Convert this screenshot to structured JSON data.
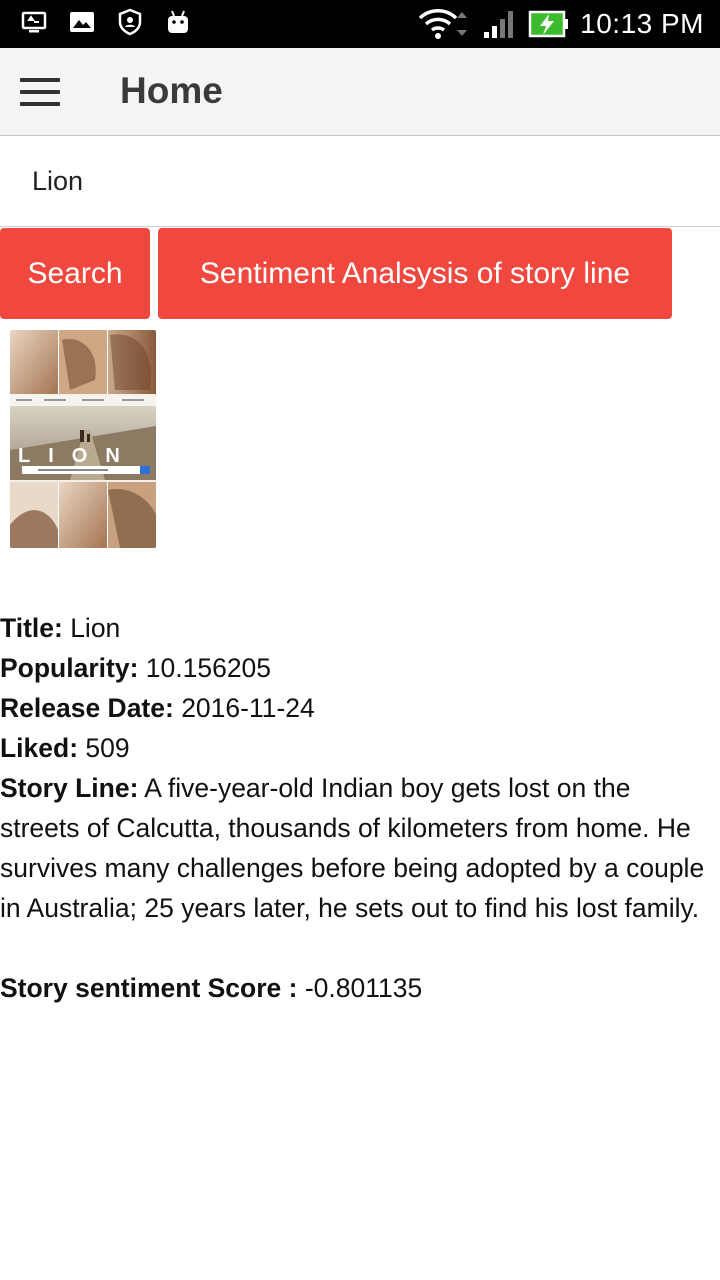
{
  "status_bar": {
    "time": "10:13 PM",
    "icons": [
      "screen-cast-icon",
      "image-icon",
      "shield-icon",
      "android-icon",
      "wifi-icon",
      "signal-icon",
      "battery-charging-icon"
    ]
  },
  "app_bar": {
    "title": "Home",
    "menu_icon": "hamburger-menu-icon"
  },
  "search": {
    "value": "Lion",
    "placeholder": ""
  },
  "buttons": {
    "search_label": "Search",
    "sentiment_label": "Sentiment Analsysis of story line"
  },
  "poster": {
    "title_text": "LION"
  },
  "movie": {
    "title_label": "Title:",
    "title_value": " Lion",
    "popularity_label": "Popularity:",
    "popularity_value": " 10.156205",
    "release_label": "Release Date:",
    "release_value": " 2016-11-24",
    "liked_label": "Liked:",
    "liked_value": " 509",
    "story_label": "Story Line:",
    "story_value": " A five-year-old Indian boy gets lost on the streets of Calcutta, thousands of kilometers from home. He survives many challenges before being adopted by a couple in Australia; 25 years later, he sets out to find his lost family.",
    "score_label": "Story sentiment Score :",
    "score_value": " -0.801135"
  },
  "colors": {
    "accent": "#f0483e",
    "app_bar_bg": "#f5f5f5",
    "status_bar_bg": "#000000"
  }
}
